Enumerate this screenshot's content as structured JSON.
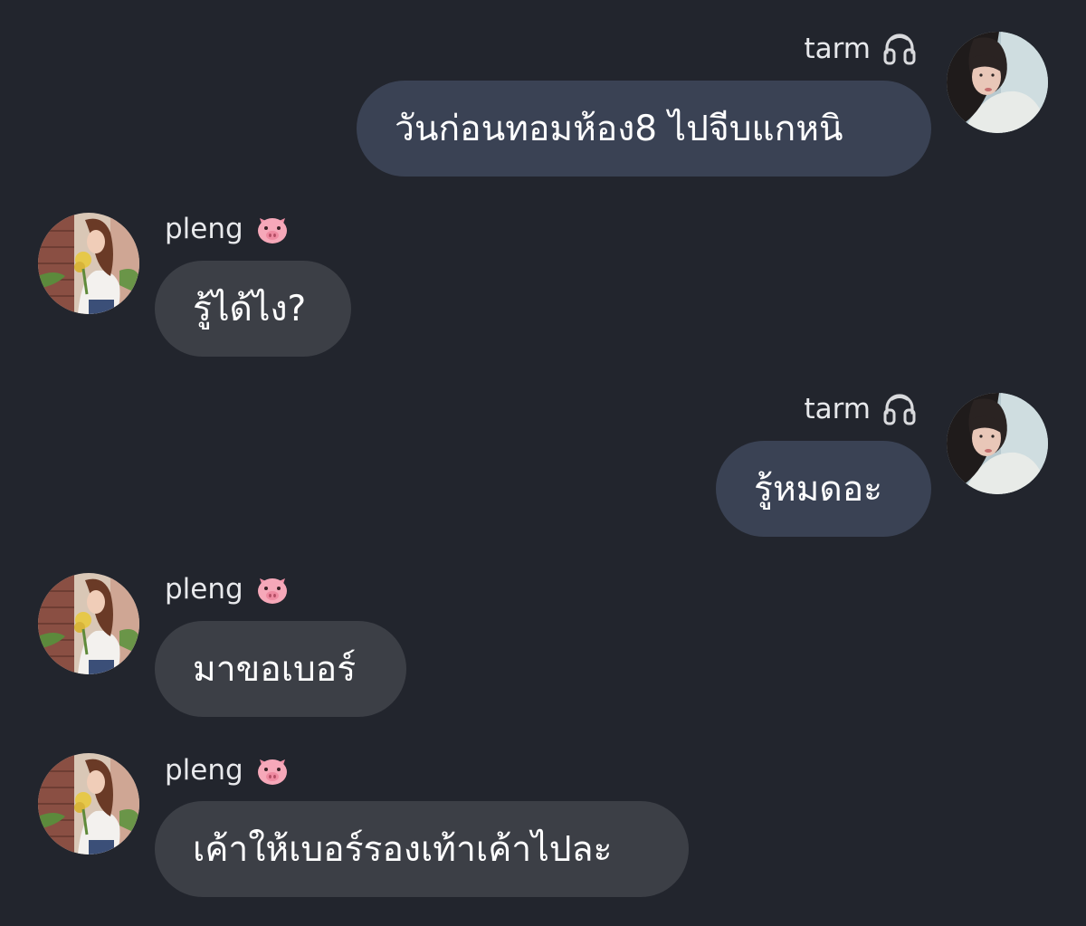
{
  "colors": {
    "background": "#22252d",
    "bubble_outgoing": "#3a4254",
    "bubble_incoming": "#3c3f46",
    "text": "#ffffff"
  },
  "messages": [
    {
      "sender": "tarm",
      "sender_icon": "headphones-icon",
      "text": "วันก่อนทอมห้อง8 ไปจีบแกหนิ"
    },
    {
      "sender": "pleng",
      "sender_icon": "pig-face-icon",
      "text": "รู้ได้ไง?"
    },
    {
      "sender": "tarm",
      "sender_icon": "headphones-icon",
      "text": "รู้หมดอะ"
    },
    {
      "sender": "pleng",
      "sender_icon": "pig-face-icon",
      "text": "มาขอเบอร์"
    },
    {
      "sender": "pleng",
      "sender_icon": "pig-face-icon",
      "text": "เค้าให้เบอร์รองเท้าเค้าไปละ"
    }
  ]
}
